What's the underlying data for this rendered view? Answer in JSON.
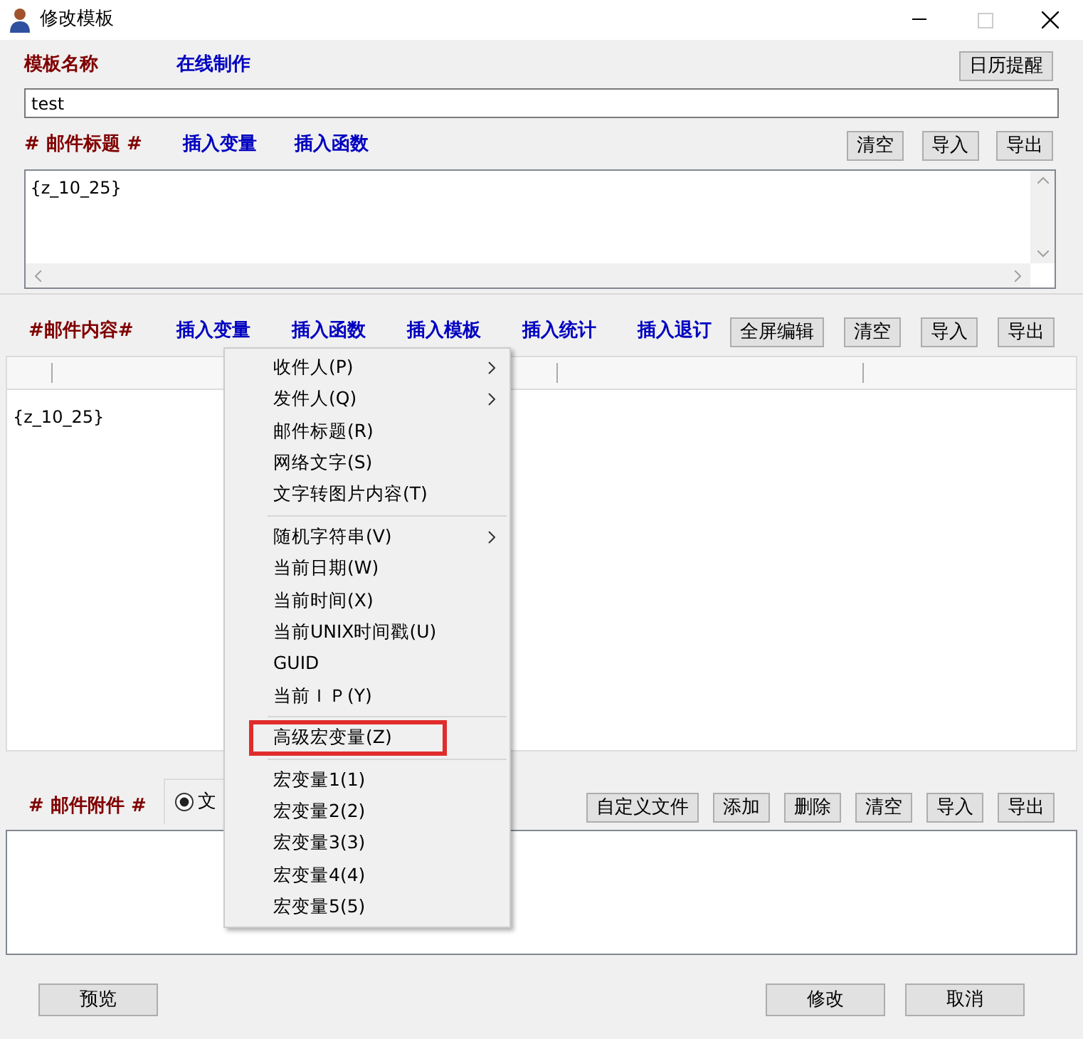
{
  "window": {
    "title": "修改模板"
  },
  "template": {
    "label": "模板名称",
    "link": "在线制作",
    "button": "日历提醒",
    "value": "test"
  },
  "subject": {
    "label": "# 邮件标题 #",
    "links": [
      "插入变量",
      "插入函数"
    ],
    "buttons": [
      "清空",
      "导入",
      "导出"
    ],
    "value": "{z_10_25}"
  },
  "content": {
    "label": "#邮件内容#",
    "links": [
      "插入变量",
      "插入函数",
      "插入模板",
      "插入统计",
      "插入退订"
    ],
    "buttons": [
      "全屏编辑",
      "清空",
      "导入",
      "导出"
    ],
    "value": "{z_10_25}"
  },
  "attachments": {
    "label": "# 邮件附件 #",
    "radio": {
      "label": "文",
      "selected": true
    },
    "buttons": [
      "自定义文件",
      "添加",
      "删除",
      "清空",
      "导入",
      "导出"
    ]
  },
  "footer_buttons": [
    "预览",
    "修改",
    "取消"
  ],
  "context_menu": [
    {
      "kind": "item",
      "label": "收件人(P)",
      "submenu": true,
      "highlighted": false
    },
    {
      "kind": "item",
      "label": "发件人(Q)",
      "submenu": true,
      "highlighted": false
    },
    {
      "kind": "item",
      "label": "邮件标题(R)",
      "submenu": false,
      "highlighted": false
    },
    {
      "kind": "item",
      "label": "网络文字(S)",
      "submenu": false,
      "highlighted": false
    },
    {
      "kind": "item",
      "label": "文字转图片内容(T)",
      "submenu": false,
      "highlighted": false
    },
    {
      "kind": "separator"
    },
    {
      "kind": "item",
      "label": "随机字符串(V)",
      "submenu": true,
      "highlighted": false
    },
    {
      "kind": "item",
      "label": "当前日期(W)",
      "submenu": false,
      "highlighted": false
    },
    {
      "kind": "item",
      "label": "当前时间(X)",
      "submenu": false,
      "highlighted": false
    },
    {
      "kind": "item",
      "label": "当前UNIX时间戳(U)",
      "submenu": false,
      "highlighted": false
    },
    {
      "kind": "item",
      "label": "GUID",
      "submenu": false,
      "highlighted": false
    },
    {
      "kind": "item",
      "label": "当前ＩＰ(Y)",
      "submenu": false,
      "highlighted": false
    },
    {
      "kind": "separator"
    },
    {
      "kind": "item",
      "label": "高级宏变量(Z)",
      "submenu": false,
      "highlighted": true
    },
    {
      "kind": "separator"
    },
    {
      "kind": "item",
      "label": "宏变量1(1)",
      "submenu": false,
      "highlighted": false
    },
    {
      "kind": "item",
      "label": "宏变量2(2)",
      "submenu": false,
      "highlighted": false
    },
    {
      "kind": "item",
      "label": "宏变量3(3)",
      "submenu": false,
      "highlighted": false
    },
    {
      "kind": "item",
      "label": "宏变量4(4)",
      "submenu": false,
      "highlighted": false
    },
    {
      "kind": "item",
      "label": "宏变量5(5)",
      "submenu": false,
      "highlighted": false
    }
  ]
}
